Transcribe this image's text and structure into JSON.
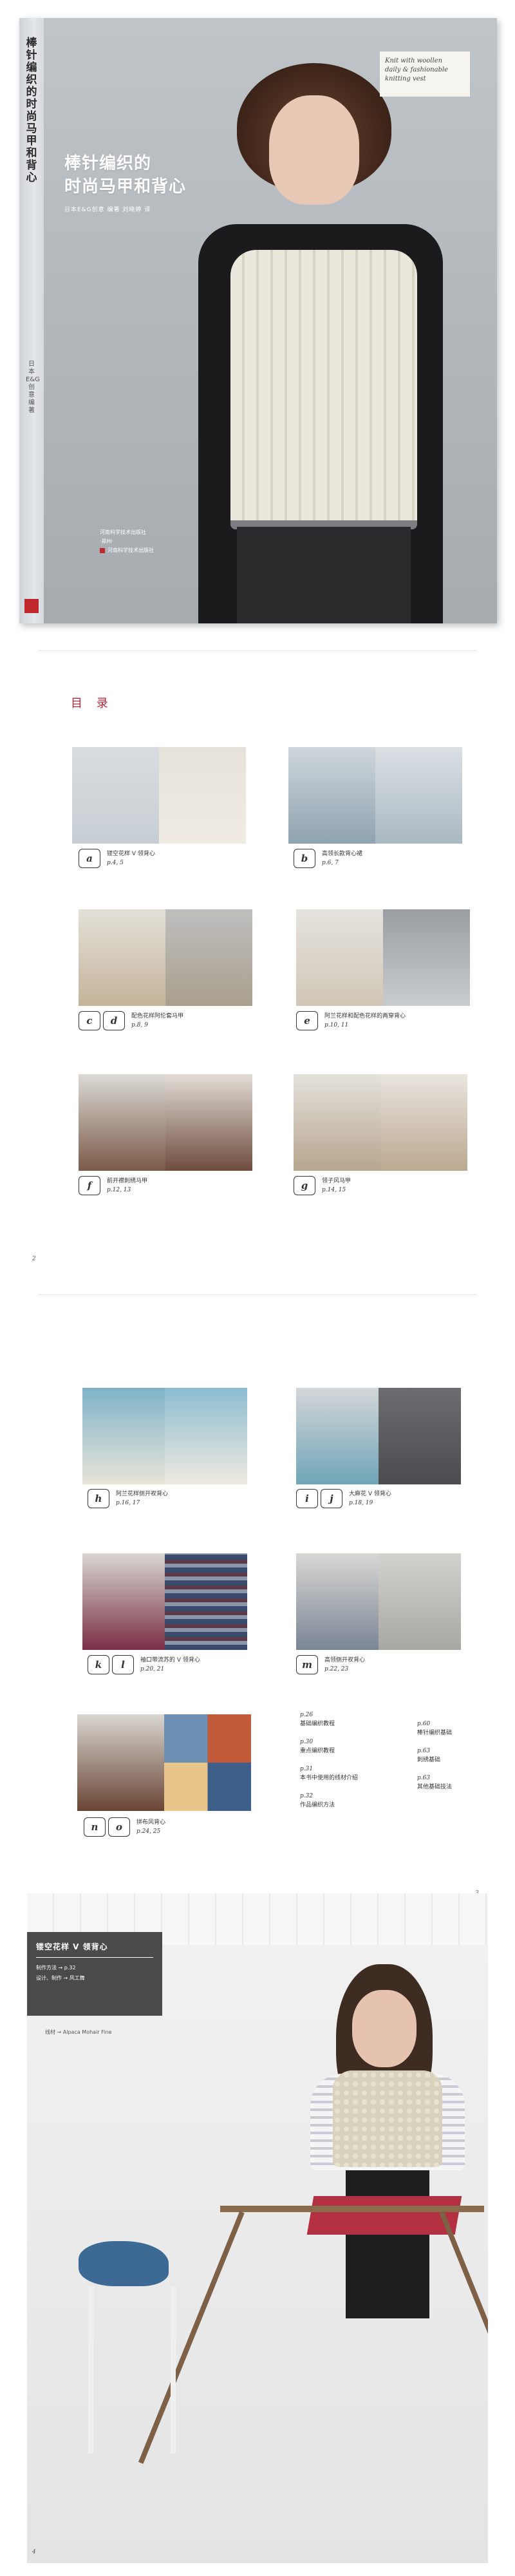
{
  "cover": {
    "title_line1": "棒针编织的",
    "title_line2": "时尚马甲和背心",
    "spine_title": "棒针编织的时尚马甲和背心",
    "spine_sub": "日本E&G创意编著",
    "author": "日本E&G创意  编著    刘晓婷  译",
    "english_lines": [
      "Knit with woollen",
      "daily & fashionable",
      "knitting vest"
    ],
    "publisher_lines": [
      "河南科学技术出版社",
      "·郑州·"
    ],
    "publisher_name": "河南科学技术出版社"
  },
  "toc": {
    "title": "目  录",
    "page_left": "2",
    "page_right": "3",
    "items": [
      {
        "letters": [
          "a"
        ],
        "name": "镂空花样 V 领背心",
        "pages": "p.4, 5"
      },
      {
        "letters": [
          "b"
        ],
        "name": "高领长款背心裙",
        "pages": "p.6, 7"
      },
      {
        "letters": [
          "c",
          "d"
        ],
        "name": "配色花样阿伦套马甲",
        "pages": "p.8, 9"
      },
      {
        "letters": [
          "e"
        ],
        "name": "阿兰花样和配色花样的两穿背心",
        "pages": "p.10, 11"
      },
      {
        "letters": [
          "f"
        ],
        "name": "前开襟刺绣马甲",
        "pages": "p.12, 13"
      },
      {
        "letters": [
          "g"
        ],
        "name": "领子风马甲",
        "pages": "p.14, 15"
      },
      {
        "letters": [
          "h"
        ],
        "name": "阿兰花样侧开衩背心",
        "pages": "p.16, 17"
      },
      {
        "letters": [
          "i",
          "j"
        ],
        "name": "大麻花 V 领背心",
        "pages": "p.18, 19"
      },
      {
        "letters": [
          "k",
          "l"
        ],
        "name": "袖口带流苏的 V 领背心",
        "pages": "p.20, 21"
      },
      {
        "letters": [
          "m"
        ],
        "name": "高领侧开衩背心",
        "pages": "p.22, 23"
      },
      {
        "letters": [
          "n",
          "o"
        ],
        "name": "拼布风背心",
        "pages": "p.24, 25"
      }
    ],
    "index": [
      {
        "page": "p.26",
        "text": "基础编织教程"
      },
      {
        "page": "p.30",
        "text": "重点编织教程"
      },
      {
        "page": "p.31",
        "text": "本书中使用的线材介绍"
      },
      {
        "page": "p.32",
        "text": "作品编织方法"
      },
      {
        "page": "p.60",
        "text": "棒针编织基础"
      },
      {
        "page": "p.63",
        "text": "刺绣基础"
      },
      {
        "page": "p.63",
        "text": "其他基础技法"
      }
    ]
  },
  "page4": {
    "title": "镂空花样 V 领背心",
    "method": "制作方法 → p.32",
    "design": "设计、制作 → 风工舞",
    "yarn": "线材 → Alpaca Mohair Fine",
    "page_num": "4"
  },
  "colors": {
    "accent_red": "#b32638",
    "info_box": "#4a4a4a"
  }
}
